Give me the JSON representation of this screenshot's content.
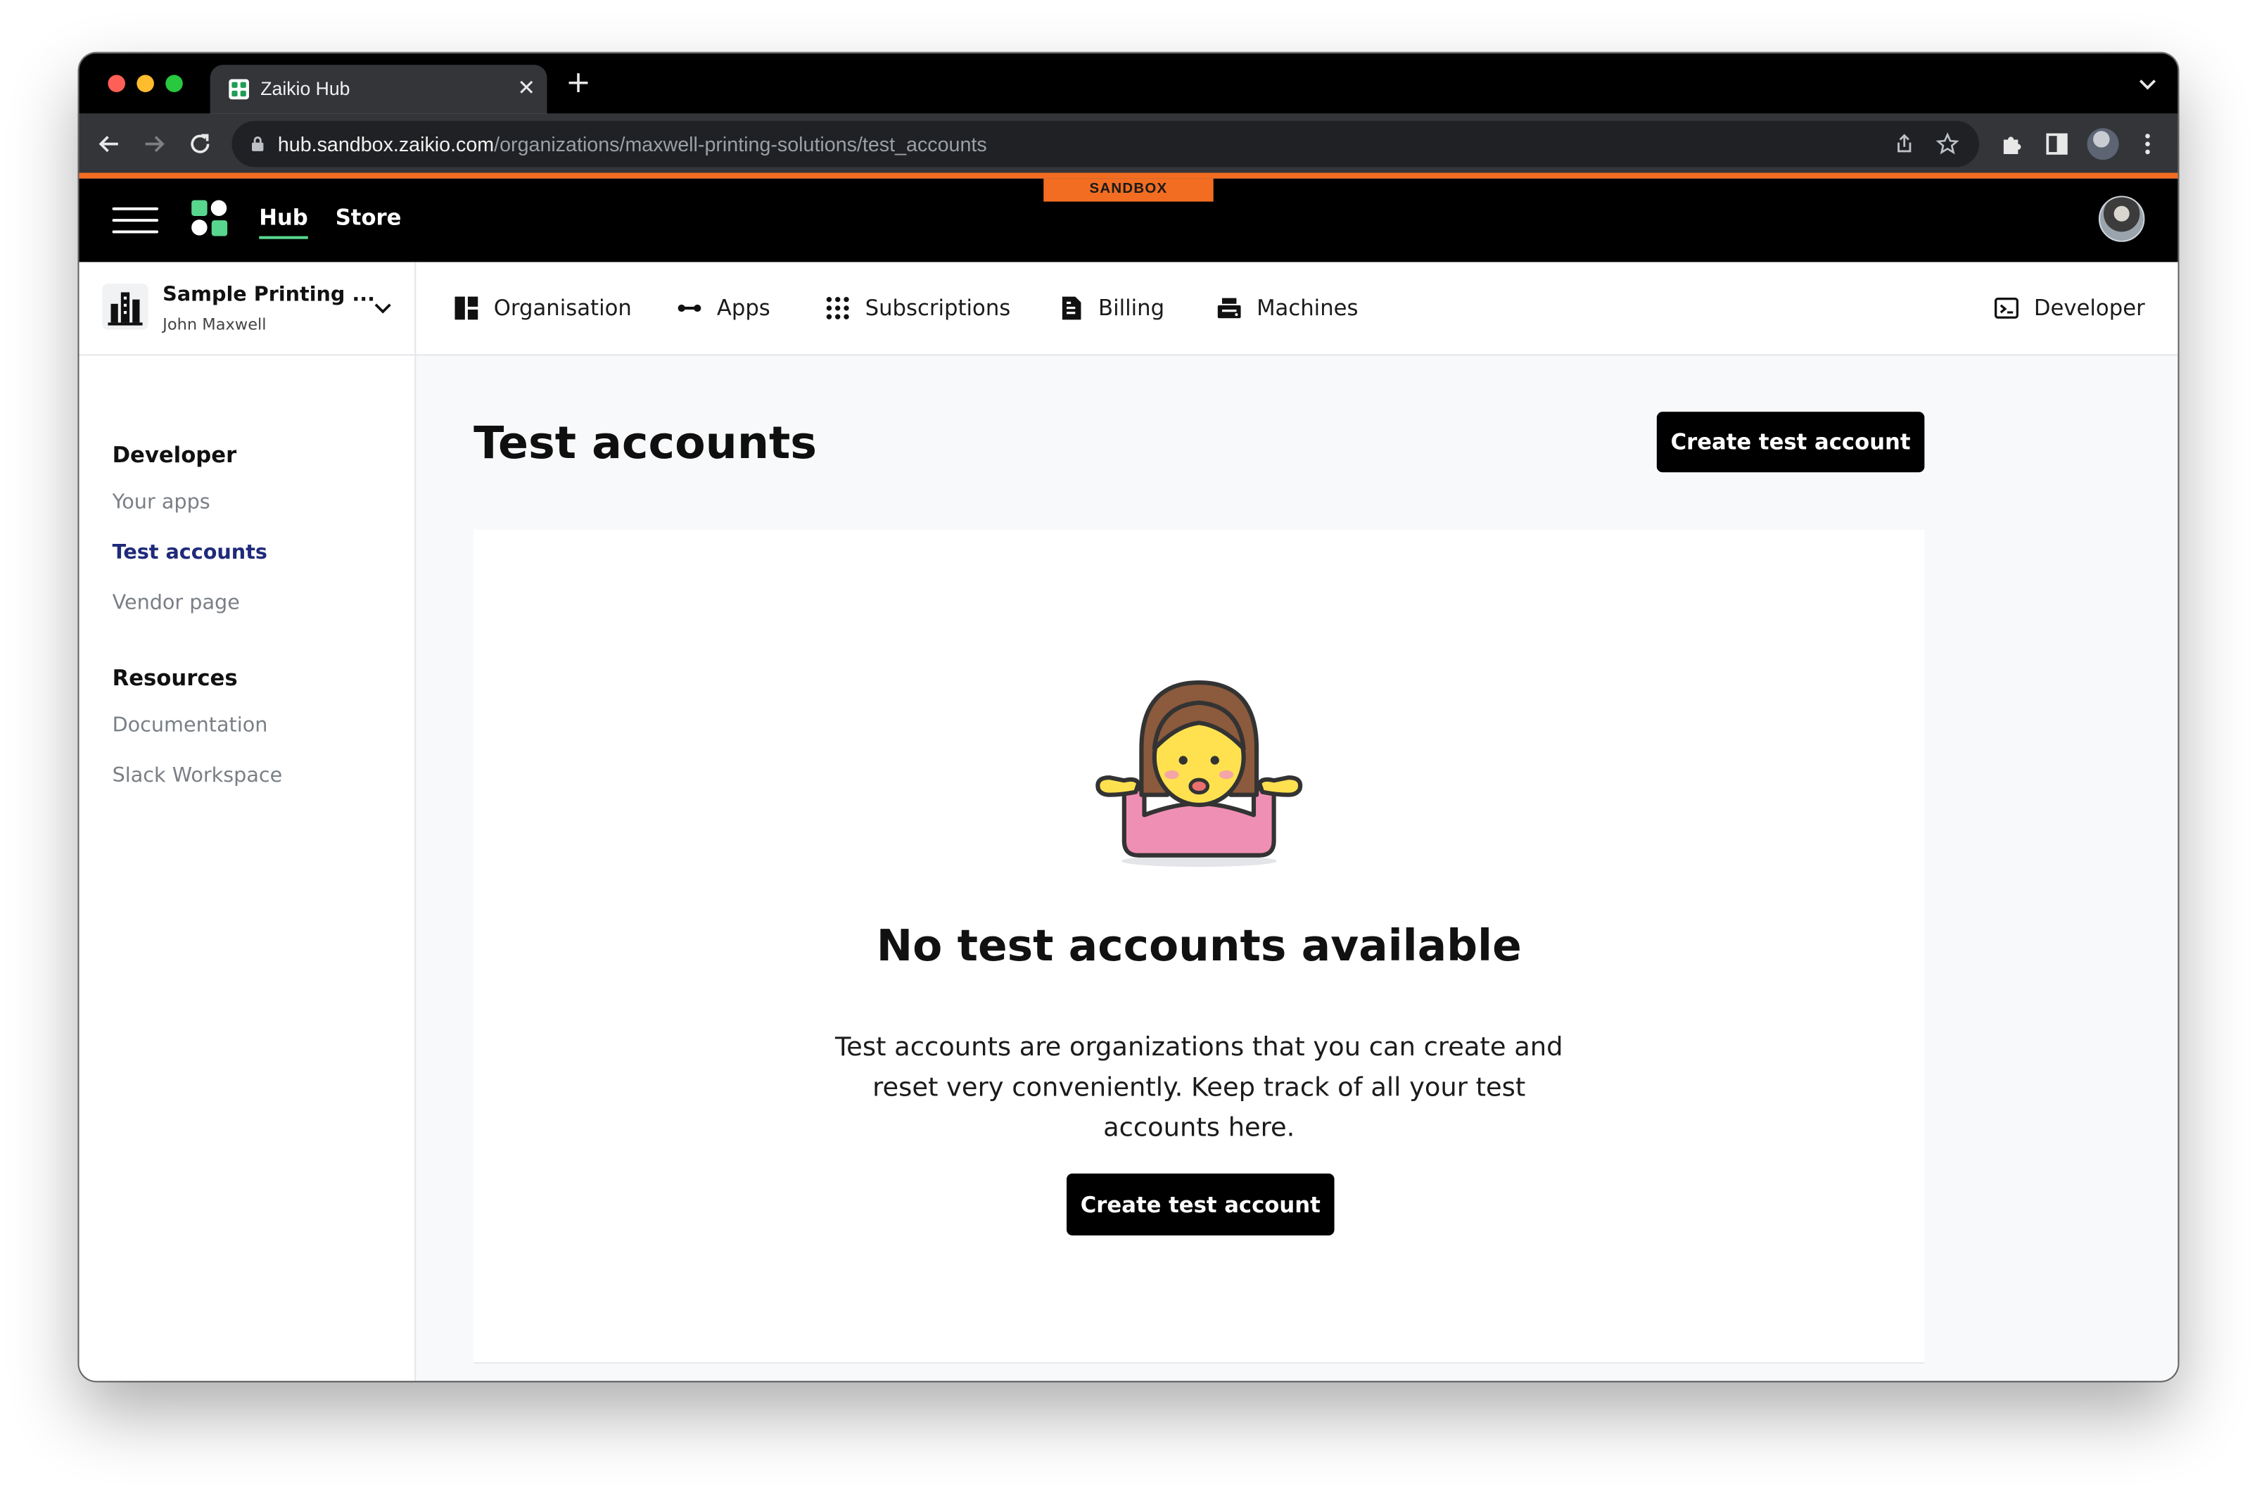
{
  "browser": {
    "tab_title": "Zaikio Hub",
    "url_host": "hub.sandbox.zaikio.com",
    "url_path": "/organizations/maxwell-printing-solutions/test_accounts",
    "new_tab": "+",
    "close_tab": "✕"
  },
  "header": {
    "environment_badge": "SANDBOX",
    "nav": [
      {
        "label": "Hub",
        "active": true
      },
      {
        "label": "Store",
        "active": false
      }
    ]
  },
  "org_switcher": {
    "org_name": "Sample Printing ...",
    "user_name": "John Maxwell"
  },
  "section_nav": {
    "items": [
      {
        "label": "Organisation",
        "icon": "dashboard-icon"
      },
      {
        "label": "Apps",
        "icon": "apps-connector-icon"
      },
      {
        "label": "Subscriptions",
        "icon": "grid-dots-icon"
      },
      {
        "label": "Billing",
        "icon": "invoice-icon"
      },
      {
        "label": "Machines",
        "icon": "printer-machine-icon"
      }
    ],
    "developer": {
      "label": "Developer",
      "icon": "terminal-icon"
    }
  },
  "sidebar": {
    "groups": [
      {
        "heading": "Developer",
        "links": [
          {
            "label": "Your apps",
            "active": false
          },
          {
            "label": "Test accounts",
            "active": true
          },
          {
            "label": "Vendor page",
            "active": false
          }
        ]
      },
      {
        "heading": "Resources",
        "links": [
          {
            "label": "Documentation",
            "active": false
          },
          {
            "label": "Slack Workspace",
            "active": false
          }
        ]
      }
    ]
  },
  "main": {
    "title": "Test accounts",
    "primary_action": "Create test account",
    "empty_state": {
      "illustration": "woman-shrugging-icon",
      "title": "No test accounts available",
      "description": "Test accounts are organizations that you can create and reset very conveniently. Keep track of all your test accounts here.",
      "action": "Create test account"
    }
  },
  "colors": {
    "accent": "#f26d21",
    "active_underline": "#58d68d",
    "active_link": "#1f2a7a",
    "button": "#000000"
  }
}
